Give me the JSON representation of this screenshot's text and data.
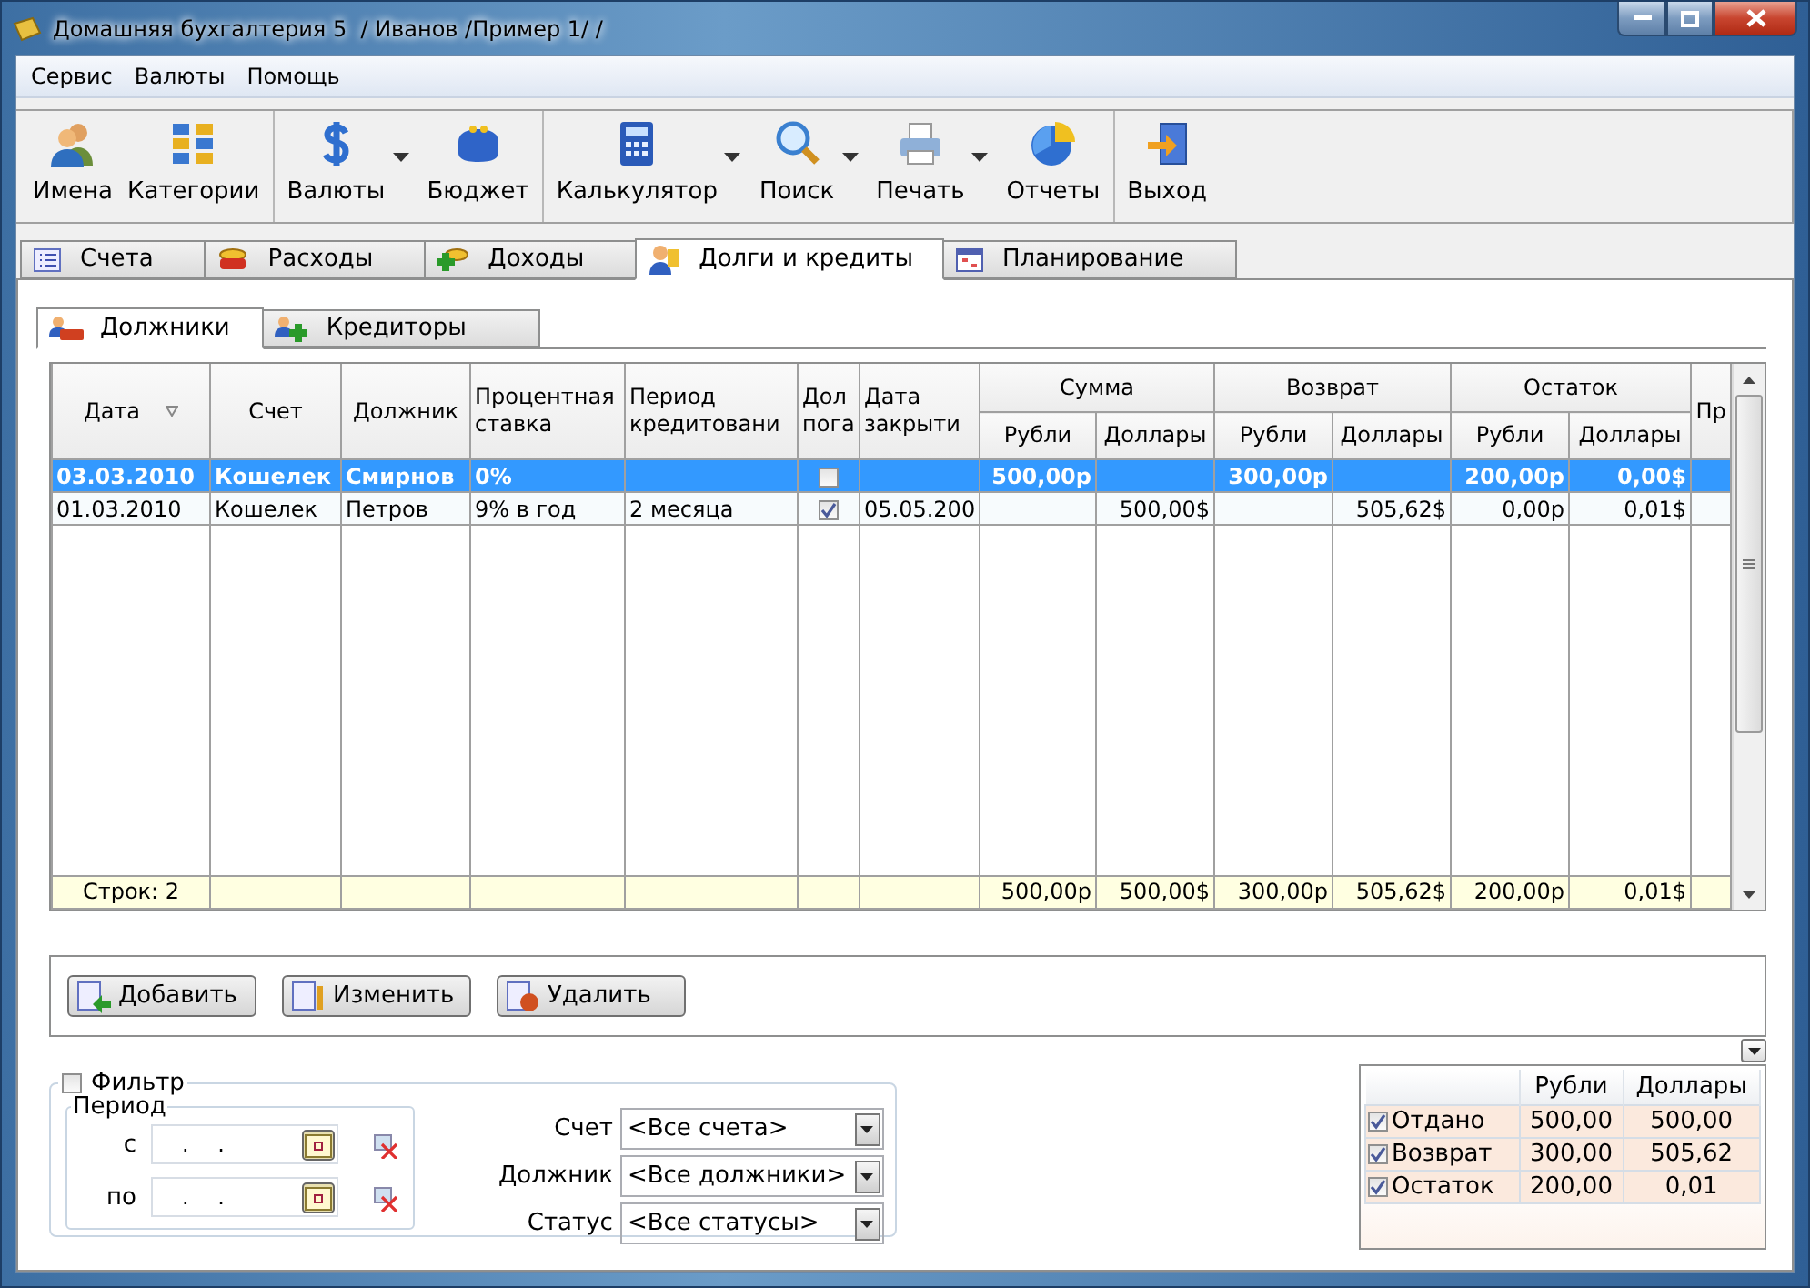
{
  "window": {
    "title": "Домашняя бухгалтерия 5  / Иванов /Пример 1/ /"
  },
  "menu": [
    "Сервис",
    "Валюты",
    "Помощь"
  ],
  "toolbar": [
    {
      "items": [
        {
          "label": "Имена",
          "dropdown": false
        },
        {
          "label": "Категории",
          "dropdown": false
        }
      ]
    },
    {
      "items": [
        {
          "label": "Валюты",
          "dropdown": true
        },
        {
          "label": "Бюджет",
          "dropdown": false
        }
      ]
    },
    {
      "items": [
        {
          "label": "Калькулятор",
          "dropdown": true
        },
        {
          "label": "Поиск",
          "dropdown": true
        },
        {
          "label": "Печать",
          "dropdown": true
        },
        {
          "label": "Отчеты",
          "dropdown": false
        }
      ]
    },
    {
      "items": [
        {
          "label": "Выход",
          "dropdown": false
        }
      ]
    }
  ],
  "tabs": [
    {
      "label": "Счета",
      "selected": false
    },
    {
      "label": "Расходы",
      "selected": false
    },
    {
      "label": "Доходы",
      "selected": false
    },
    {
      "label": "Долги и кредиты",
      "selected": true
    },
    {
      "label": "Планирование",
      "selected": false
    }
  ],
  "subtabs": [
    {
      "label": "Должники",
      "selected": true
    },
    {
      "label": "Кредиторы",
      "selected": false
    }
  ],
  "table": {
    "columns": [
      {
        "label": "Дата",
        "sorted": true
      },
      {
        "label": "Счет",
        "sorted": false
      },
      {
        "label": "Должник",
        "sorted": false
      },
      {
        "label": "Процентная\nставка",
        "sorted": false
      },
      {
        "label": "Период\nкредитовани",
        "sorted": false
      },
      {
        "label": "Дол\nпога",
        "sorted": false
      },
      {
        "label": "Дата\nзакрыти",
        "sorted": false
      },
      {
        "label": "Сумма",
        "colspan": 2,
        "columns": [
          "Рубли",
          "Доллары"
        ]
      },
      {
        "label": "Возврат",
        "colspan": 2,
        "columns": [
          "Рубли",
          "Доллары"
        ]
      },
      {
        "label": "Остаток",
        "colspan": 2,
        "columns": [
          "Рубли",
          "Доллары"
        ]
      },
      {
        "label": "Пр",
        "sorted": false
      }
    ],
    "rows": [
      {
        "selected": true,
        "cells": [
          "03.03.2010",
          "Кошелек",
          "Смирнов",
          "0%",
          null,
          {
            "checked": false
          },
          null,
          "500,00р",
          null,
          "300,00р",
          null,
          "200,00р",
          "0,00$",
          null
        ]
      },
      {
        "selected": false,
        "cells": [
          "01.03.2010",
          "Кошелек",
          "Петров",
          "9% в год",
          "2 месяца",
          {
            "checked": true
          },
          "05.05.200",
          null,
          "500,00$",
          null,
          "505,62$",
          "0,00р",
          "0,01$",
          null
        ]
      }
    ],
    "footer": {
      "cells": [
        "Строк: 2",
        null,
        null,
        null,
        null,
        null,
        null,
        "500,00р",
        "500,00$",
        "300,00р",
        "505,62$",
        "200,00р",
        "0,01$",
        null
      ]
    }
  },
  "buttons": [
    {
      "label": "Добавить"
    },
    {
      "label": "Изменить"
    },
    {
      "label": "Удалить"
    }
  ],
  "filter": {
    "label": "Фильтр",
    "checked": false,
    "period": {
      "legend": "Период",
      "fields": [
        {
          "label": "с",
          "value": ". ."
        },
        {
          "label": "по",
          "value": ". ."
        }
      ]
    },
    "selects": [
      {
        "label": "Счет",
        "value": "<Все счета>"
      },
      {
        "label": "Должник",
        "value": "<Все должники>"
      },
      {
        "label": "Статус",
        "value": "<Все статусы>"
      }
    ]
  },
  "summary": {
    "columns": [
      "Рубли",
      "Доллары"
    ],
    "rows": [
      {
        "checked": true,
        "label": "Отдано",
        "values": [
          "500,00",
          "500,00"
        ]
      },
      {
        "checked": true,
        "label": "Возврат",
        "values": [
          "300,00",
          "505,62"
        ]
      },
      {
        "checked": true,
        "label": "Остаток",
        "values": [
          "200,00",
          "0,01"
        ]
      }
    ]
  }
}
